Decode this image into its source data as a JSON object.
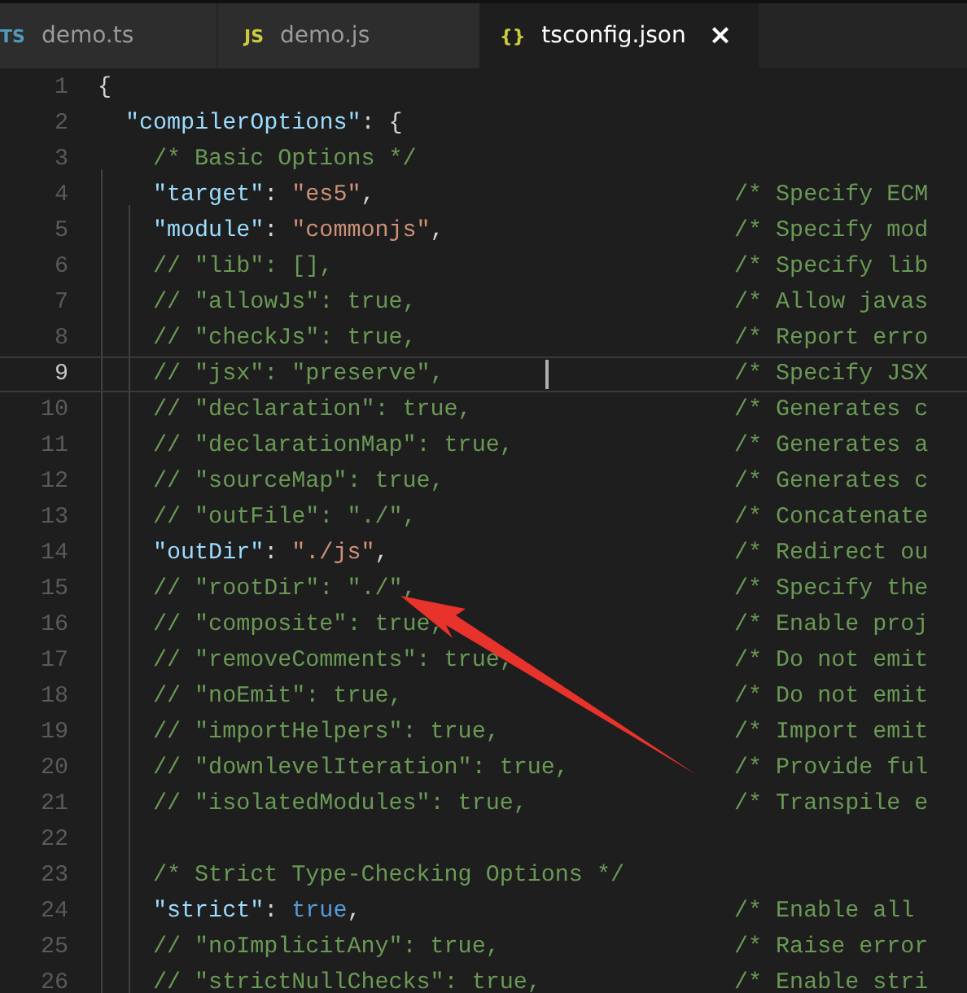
{
  "tabs": [
    {
      "icon": "TS",
      "color": "#519aba",
      "label": "demo.ts",
      "selected": false
    },
    {
      "icon": "JS",
      "color": "#cbcb41",
      "label": "demo.js",
      "selected": false
    },
    {
      "icon": "{}",
      "color": "#cbcb41",
      "label": "tsconfig.json",
      "selected": true,
      "close": "×"
    }
  ],
  "editor": {
    "lines": [
      {
        "number": "1",
        "current": false,
        "tokens": [
          {
            "kind": "punct",
            "text": "{"
          }
        ],
        "children": [
          {
            "number": "2",
            "current": false,
            "tokens": [
              {
                "kind": "key",
                "text": "\"compilerOptions\""
              },
              {
                "kind": "punct",
                "text": ": {"
              }
            ],
            "children": [
              {
                "number": "3",
                "current": false,
                "tokens": [
                  {
                    "kind": "comment",
                    "text": "/* Basic Options */"
                  }
                ]
              },
              {
                "number": "4",
                "current": false,
                "tokens": [
                  {
                    "kind": "key",
                    "text": "\"target\""
                  },
                  {
                    "kind": "punct",
                    "text": ": "
                  },
                  {
                    "kind": "string",
                    "text": "\"es5\""
                  },
                  {
                    "kind": "punct",
                    "text": ","
                  }
                ],
                "comment": "/* Specify ECM"
              },
              {
                "number": "5",
                "current": false,
                "tokens": [
                  {
                    "kind": "key",
                    "text": "\"module\""
                  },
                  {
                    "kind": "punct",
                    "text": ": "
                  },
                  {
                    "kind": "string",
                    "text": "\"commonjs\""
                  },
                  {
                    "kind": "punct",
                    "text": ","
                  }
                ],
                "comment": "/* Specify mod"
              },
              {
                "number": "6",
                "current": false,
                "tokens": [
                  {
                    "kind": "comment",
                    "text": "// \"lib\": [],"
                  }
                ],
                "comment": "/* Specify lib"
              },
              {
                "number": "7",
                "current": false,
                "tokens": [
                  {
                    "kind": "comment",
                    "text": "// \"allowJs\": true,"
                  }
                ],
                "comment": "/* Allow javas"
              },
              {
                "number": "8",
                "current": false,
                "tokens": [
                  {
                    "kind": "comment",
                    "text": "// \"checkJs\": true,"
                  }
                ],
                "comment": "/* Report erro"
              },
              {
                "number": "9",
                "current": true,
                "tokens": [
                  {
                    "kind": "comment",
                    "text": "// \"jsx\": \"preserve\","
                  }
                ],
                "comment": "/* Specify JSX"
              },
              {
                "number": "10",
                "current": false,
                "tokens": [
                  {
                    "kind": "comment",
                    "text": "// \"declaration\": true,"
                  }
                ],
                "comment": "/* Generates c"
              },
              {
                "number": "11",
                "current": false,
                "tokens": [
                  {
                    "kind": "comment",
                    "text": "// \"declarationMap\": true,"
                  }
                ],
                "comment": "/* Generates a"
              },
              {
                "number": "12",
                "current": false,
                "tokens": [
                  {
                    "kind": "comment",
                    "text": "// \"sourceMap\": true,"
                  }
                ],
                "comment": "/* Generates c"
              },
              {
                "number": "13",
                "current": false,
                "tokens": [
                  {
                    "kind": "comment",
                    "text": "// \"outFile\": \"./\","
                  }
                ],
                "comment": "/* Concatenate"
              },
              {
                "number": "14",
                "current": false,
                "tokens": [
                  {
                    "kind": "key",
                    "text": "\"outDir\""
                  },
                  {
                    "kind": "punct",
                    "text": ": "
                  },
                  {
                    "kind": "string",
                    "text": "\"./js\""
                  },
                  {
                    "kind": "punct",
                    "text": ","
                  }
                ],
                "comment": "/* Redirect ou"
              },
              {
                "number": "15",
                "current": false,
                "tokens": [
                  {
                    "kind": "comment",
                    "text": "// \"rootDir\": \"./\","
                  }
                ],
                "comment": "/* Specify the"
              },
              {
                "number": "16",
                "current": false,
                "tokens": [
                  {
                    "kind": "comment",
                    "text": "// \"composite\": true,"
                  }
                ],
                "comment": "/* Enable proj"
              },
              {
                "number": "17",
                "current": false,
                "tokens": [
                  {
                    "kind": "comment",
                    "text": "// \"removeComments\": true,"
                  }
                ],
                "comment": "/* Do not emit"
              },
              {
                "number": "18",
                "current": false,
                "tokens": [
                  {
                    "kind": "comment",
                    "text": "// \"noEmit\": true,"
                  }
                ],
                "comment": "/* Do not emit"
              },
              {
                "number": "19",
                "current": false,
                "tokens": [
                  {
                    "kind": "comment",
                    "text": "// \"importHelpers\": true,"
                  }
                ],
                "comment": "/* Import emit"
              },
              {
                "number": "20",
                "current": false,
                "tokens": [
                  {
                    "kind": "comment",
                    "text": "// \"downlevelIteration\": true,"
                  }
                ],
                "comment": "/* Provide ful"
              },
              {
                "number": "21",
                "current": false,
                "tokens": [
                  {
                    "kind": "comment",
                    "text": "// \"isolatedModules\": true,"
                  }
                ],
                "comment": "/* Transpile e"
              },
              {
                "number": "22",
                "current": false
              },
              {
                "number": "23",
                "current": false,
                "tokens": [
                  {
                    "kind": "comment",
                    "text": "/* Strict Type-Checking Options */"
                  }
                ]
              },
              {
                "number": "24",
                "current": false,
                "tokens": [
                  {
                    "kind": "key",
                    "text": "\"strict\""
                  },
                  {
                    "kind": "punct",
                    "text": ": "
                  },
                  {
                    "kind": "bool",
                    "text": "true"
                  },
                  {
                    "kind": "punct",
                    "text": ","
                  }
                ],
                "comment": "/* Enable all"
              },
              {
                "number": "25",
                "current": false,
                "tokens": [
                  {
                    "kind": "comment",
                    "text": "// \"noImplicitAny\": true,"
                  }
                ],
                "comment": "/* Raise error"
              },
              {
                "number": "26",
                "current": false,
                "tokens": [
                  {
                    "kind": "comment",
                    "text": "// \"strictNullChecks\": true,"
                  }
                ],
                "comment": "/* Enable stri"
              }
            ]
          }
        ]
      }
    ]
  }
}
